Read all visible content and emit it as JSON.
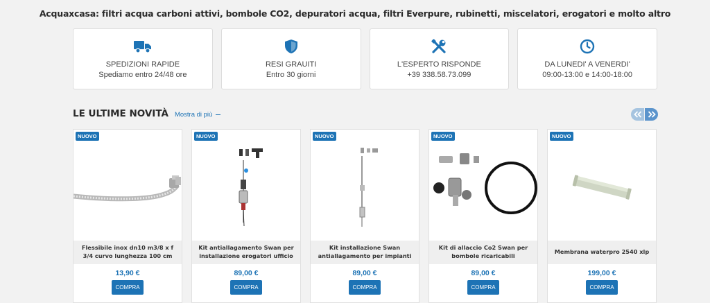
{
  "header": {
    "tagline": "Acquaxcasa: filtri acqua carboni attivi, bombole CO2, depuratori acqua, filtri Everpure, rubinetti, miscelatori, erogatori e molto altro"
  },
  "features": [
    {
      "icon": "truck-icon",
      "title": "SPEDIZIONI RAPIDE",
      "subtitle": "Spediamo entro 24/48 ore"
    },
    {
      "icon": "shield-icon",
      "title": "RESI GRAUITI",
      "subtitle": "Entro 30 giorni"
    },
    {
      "icon": "tools-icon",
      "title": "L'ESPERTO RISPONDE",
      "subtitle": "+39 338.58.73.099"
    },
    {
      "icon": "clock-icon",
      "title": "DA LUNEDI' A VENERDI'",
      "subtitle": "09:00-13:00 e 14:00-18:00"
    }
  ],
  "section": {
    "title": "LE ULTIME NOVITÀ",
    "more_link": "Mostra di più"
  },
  "colors": {
    "accent": "#1d73b5",
    "background": "#f2f2f2"
  },
  "products": [
    {
      "badge": "NUOVO",
      "name": "Flessibile inox dn10 m3/8 x f 3/4 curvo lunghezza 100 cm",
      "price": "13,90 €",
      "button": "COMPRA"
    },
    {
      "badge": "NUOVO",
      "name": "Kit antiallagamento Swan per installazione erogatori ufficio",
      "price": "89,00 €",
      "button": "COMPRA"
    },
    {
      "badge": "NUOVO",
      "name": "Kit installazione Swan antiallagamento per impianti",
      "price": "89,00 €",
      "button": "COMPRA"
    },
    {
      "badge": "NUOVO",
      "name": "Kit di allaccio Co2 Swan per bombole ricaricabili",
      "price": "89,00 €",
      "button": "COMPRA"
    },
    {
      "badge": "NUOVO",
      "name": "Membrana waterpro 2540 xlp",
      "price": "199,00 €",
      "button": "COMPRA"
    }
  ]
}
